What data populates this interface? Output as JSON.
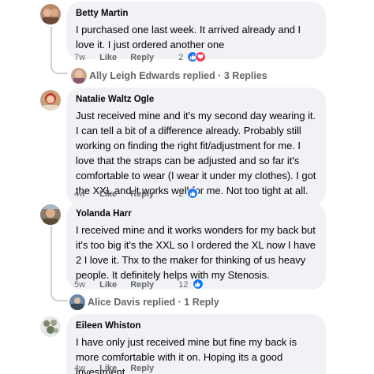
{
  "comments": [
    {
      "author": "Betty Martin",
      "text": "I purchased one last week. It arrived already and I love it. I just ordered another one",
      "time": "7w",
      "like_label": "Like",
      "reply_label": "Reply",
      "reaction_count": "2",
      "reactions": [
        "like-icon",
        "love-icon"
      ],
      "replies": "Ally Leigh Edwards replied · 3 Replies"
    },
    {
      "author": "Natalie Waltz Ogle",
      "text": "Just received mine and it's my second day wearing it. I can tell a bit of a difference already. Probably still working on finding the right fit/adjustment for me. I love that the straps can be adjusted and so far it's comfortable to wear (I wear it under my clothes). I got the XXL and it works well for me. Not too tight at all.",
      "time": "4w",
      "like_label": "Like",
      "reply_label": "Reply",
      "reaction_count": "2",
      "reactions": [
        "like-icon"
      ]
    },
    {
      "author": "Yolanda Harr",
      "text": "I received mine and it works wonders for my back but it's too big it's the XXL so I ordered the XL now I have 2 I love it. Thx to the maker for thinking of us heavy people. It definitely helps with my Stenosis.",
      "time": "5w",
      "like_label": "Like",
      "reply_label": "Reply",
      "reaction_count": "12",
      "reactions": [
        "like-icon"
      ],
      "replies": "Alice Davis replied · 1 Reply"
    },
    {
      "author": "Eileen Whiston",
      "text": "I have only just received mine but fine my back is more comfortable with it on. Hoping its a good investment.",
      "time": "4w",
      "like_label": "Like",
      "reply_label": "Reply"
    }
  ],
  "colors": {
    "bubble": "#f0f2f5",
    "meta_text": "#65676b",
    "like_blue": "#1877f2",
    "love_red": "#f33e58"
  }
}
